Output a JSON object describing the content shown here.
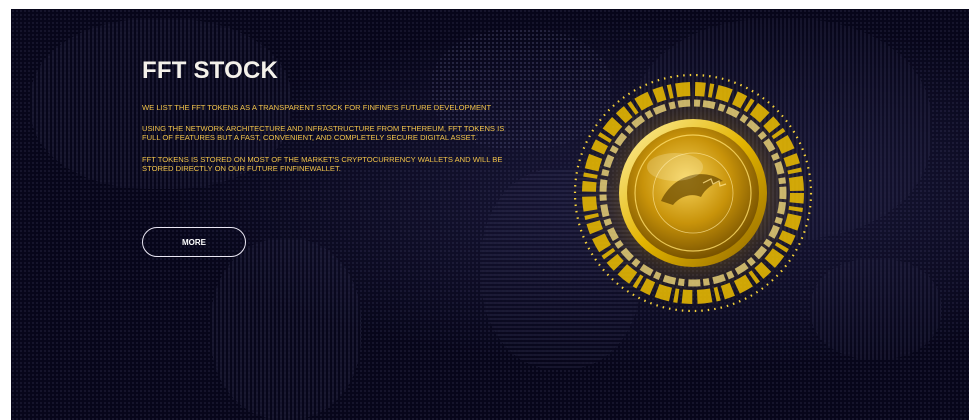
{
  "hero": {
    "title": "FFT STOCK",
    "paragraphs": [
      "WE LIST THE FFT TOKENS AS A TRANSPARENT STOCK FOR FINFINE'S FUTURE DEVELOPMENT",
      "USING THE NETWORK ARCHITECTURE AND INFRASTRUCTURE FROM ETHEREUM, FFT TOKENS IS FULL OF FEATURES BUT A FAST, CONVENIENT, AND COMPLETELY SECURE DIGITAL ASSET.",
      "FFT TOKENS IS STORED ON MOST OF THE MARKET'S CRYPTOCURRENCY WALLETS AND WILL BE STORED DIRECTLY ON OUR FUTURE FINFINEWALLET."
    ],
    "more_label": "MORE"
  },
  "colors": {
    "background": "#07061a",
    "title": "#f4f1ea",
    "paragraph": "#f1c34a",
    "coin_gold": "#f2c200"
  },
  "icons": {
    "coin": "gold-coin-icon"
  }
}
